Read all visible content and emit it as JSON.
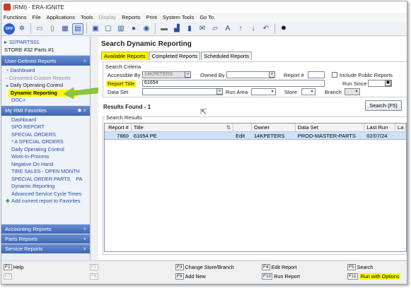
{
  "window": {
    "title": "(RMI) - ERA-IGNITE"
  },
  "menu": [
    "Functions",
    "File",
    "Applications",
    "Tools",
    "Display",
    "Reports",
    "Print",
    "System Tools",
    "Go To"
  ],
  "toolbar": {
    "off_label": "OFF",
    "icons": [
      "gear-icon",
      "folder-icon",
      "page-icon",
      "grid-icon",
      "list-icon",
      "calendar-icon",
      "document-icon",
      "scan-icon",
      "user-icon",
      "video-icon",
      "keyboard-icon",
      "chart-icon",
      "book-icon",
      "mail-icon",
      "chat-icon",
      "font-size-icon",
      "arrow-up-icon",
      "arrow-down-icon",
      "undo-icon",
      "settings-icon"
    ]
  },
  "store": {
    "code": "32/PARTS01",
    "name": "STORE #32 Parts #1"
  },
  "sidebar": {
    "user_defined": {
      "title": "User-Defined Reports",
      "items": [
        "Dashboard",
        "Converted Custom Reports",
        "Daily Operating Control",
        "Dynamic Reporting",
        "DOC+"
      ]
    },
    "favorites": {
      "title": "My RMI Favorites",
      "items": [
        "Dashboard",
        "SPO REPORT",
        "SPECIAL ORDERS",
        "* A SPECIAL ORDERS",
        "Daily Operating Control",
        "Work-In-Process",
        "Negative On Hand",
        "TIRE SALES - OPEN MONTH",
        "SPECIAL ORDER PARTS",
        "PA",
        "Dynamic Reporting",
        "Advanced Service Cycle Times",
        "Add current report to Favorites"
      ]
    },
    "bottom": [
      "Accounting Reports",
      "Parts Reports",
      "Service Reports"
    ]
  },
  "main": {
    "title": "Search Dynamic Reporting",
    "tabs": [
      "Available Reports",
      "Completed Reports",
      "Scheduled Reports"
    ],
    "criteria": {
      "legend": "Search Criteria",
      "accessible_by_label": "Accessible By",
      "accessible_by_value": "14KPETERS",
      "owned_by_label": "Owned By",
      "report_num_label": "Report #",
      "include_public_label": "Include Public Reports",
      "report_title_label": "Report Title",
      "report_title_value": "61654",
      "run_since_label": "Run Since",
      "data_set_label": "Data Set",
      "run_area_label": "Run Area",
      "store_label": "Store",
      "branch_label": "Branch"
    },
    "results_found": "Results Found - 1",
    "search_button": "Search (F5)",
    "results_legend": "Search Results",
    "columns": [
      "Report #",
      "Title",
      "",
      "Owner",
      "Data Set",
      "Last Run",
      "La"
    ],
    "rows": [
      {
        "report": "7860",
        "title": "61654 PE",
        "action": "Edit",
        "owner": "14KPETERS",
        "data_set": "PROD-MASTER-PARTS",
        "last_run": "02/07/24",
        "la": ""
      }
    ]
  },
  "fkeys": [
    {
      "key": "F1",
      "label": "Help"
    },
    {
      "key": "F2",
      "label": ""
    },
    {
      "key": "F3",
      "label": "Change Store/Branch"
    },
    {
      "key": "F4",
      "label": "Edit Report"
    },
    {
      "key": "F5",
      "label": "Search"
    },
    {
      "key": "F7",
      "label": ""
    },
    {
      "key": "F8",
      "label": ""
    },
    {
      "key": "F9",
      "label": "Add New"
    },
    {
      "key": "F10",
      "label": "Run Report"
    },
    {
      "key": "F11",
      "label": "Run with Options"
    }
  ],
  "colors": {
    "highlight": "#fff700",
    "link": "#1f4ea3",
    "section_header": "#3f66b5",
    "arrow": "#8cc63f"
  }
}
